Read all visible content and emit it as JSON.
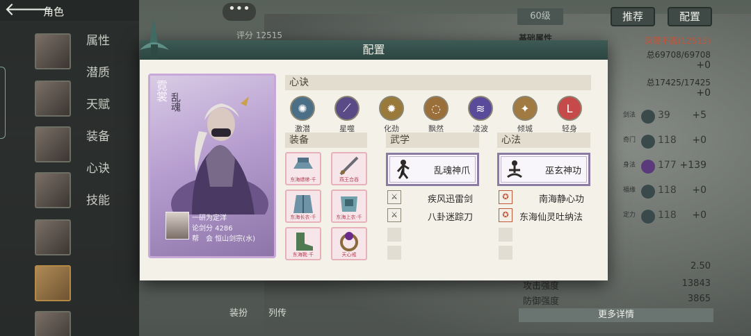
{
  "topbar": {
    "back_glyph": "🡐",
    "title": "角色"
  },
  "side_nav": [
    "属性",
    "潜质",
    "天赋",
    "装备",
    "心诀",
    "技能"
  ],
  "background": {
    "chat_glyph": "•••",
    "level": "60级",
    "score": "评分 12515",
    "buttons": {
      "recommend": "推荐",
      "config": "配置"
    },
    "basic_attr_title": "基础属性",
    "power_label": "深藏不露(12515)",
    "hp": "总69708/69708",
    "hp_plus": "+0",
    "mp": "总17425/17425",
    "mp_plus": "+0",
    "attrs": [
      {
        "name": "剑法",
        "value": "39",
        "plus": "+5"
      },
      {
        "name": "奇门",
        "value": "118",
        "plus": "+0"
      },
      {
        "name": "身法",
        "value": "177",
        "plus": "+139"
      },
      {
        "name": "福缘",
        "value": "118",
        "plus": "+0"
      },
      {
        "name": "定力",
        "value": "118",
        "plus": "+0"
      }
    ],
    "stats": [
      {
        "label": "",
        "value": "2.50"
      },
      {
        "label": "攻击强度",
        "value": "13843"
      },
      {
        "label": "防御强度",
        "value": "3865"
      }
    ],
    "more_details": "更多详情",
    "bottom_tabs": [
      "装扮",
      "列传"
    ]
  },
  "modal": {
    "title": "配置",
    "card": {
      "name": "霓裳",
      "subtitle": "乱魂",
      "player_name": "一研为定洋",
      "score_line": "论剑分 4286",
      "guild_line": "帮　会 恒山剑宗(水)"
    },
    "xinjue": {
      "header": "心诀",
      "items": [
        {
          "label": "激潜",
          "color": "#4a6f86"
        },
        {
          "label": "星噬",
          "color": "#5a4a86"
        },
        {
          "label": "化劲",
          "color": "#9a7a3a"
        },
        {
          "label": "飘然",
          "color": "#9a6f3a"
        },
        {
          "label": "凌波",
          "color": "#5a4a9a"
        },
        {
          "label": "倾城",
          "color": "#a07a40"
        },
        {
          "label": "轻身",
          "color": "#c74a4a"
        }
      ]
    },
    "equip": {
      "header": "装备",
      "items": [
        {
          "label": "东海缥缈·千"
        },
        {
          "label": "燕王合吞"
        },
        {
          "label": "东海长衣·千"
        },
        {
          "label": "东海上衣·千"
        },
        {
          "label": "东海靴·千"
        },
        {
          "label": "天心戒"
        }
      ]
    },
    "wuxue": {
      "header": "武学",
      "main": "乱魂神爪",
      "subs": [
        "疾风迅雷剑",
        "八卦迷踪刀"
      ]
    },
    "xinfa": {
      "header": "心法",
      "main": "巫玄神功",
      "subs": [
        "南海静心功",
        "东海仙灵吐纳法"
      ]
    }
  }
}
